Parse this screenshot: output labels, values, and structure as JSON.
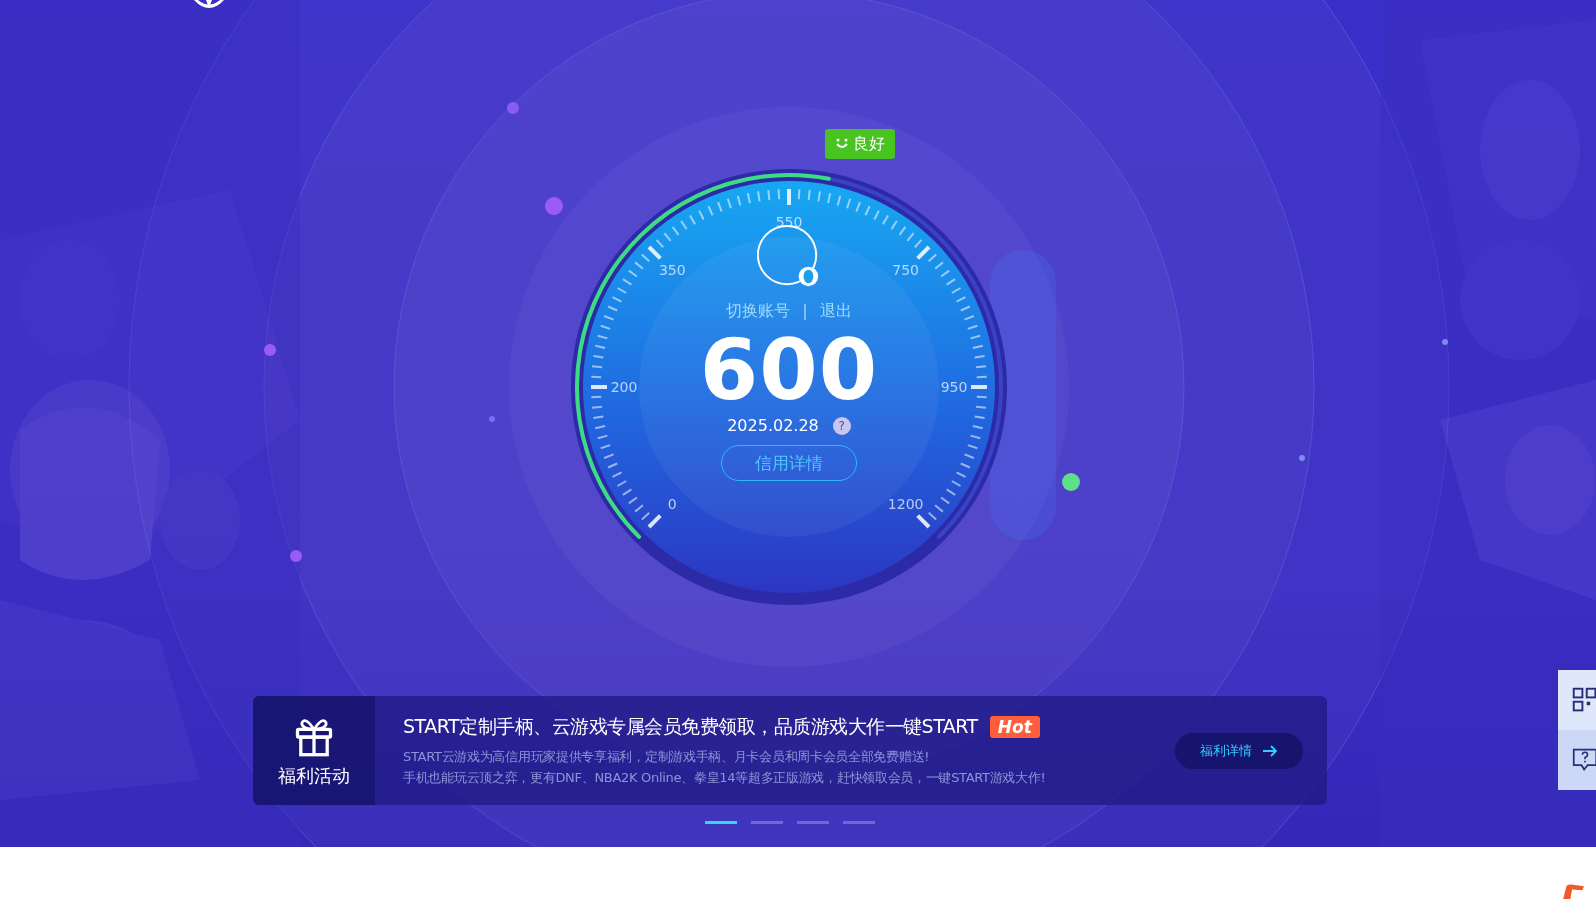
{
  "credit": {
    "status": "良好",
    "scale_labels": [
      "0",
      "200",
      "350",
      "550",
      "750",
      "950",
      "1200"
    ],
    "level": 0.54,
    "account_links": [
      {
        "label": "切换账号"
      },
      {
        "label": "退出"
      }
    ],
    "separator": "|",
    "score": "600",
    "date": "2025.02.28",
    "help": "?",
    "details_button": "信用详情"
  },
  "promo": {
    "section_label": "福利活动",
    "title": "START定制手柄、云游戏专属会员免费领取，品质游戏大作一键START",
    "tag": "Hot",
    "lines": [
      "START云游戏为高信用玩家提供专享福利，定制游戏手柄、月卡会员和周卡会员全部免费赠送!",
      "手机也能玩云顶之弈，更有DNF、NBA2K Online、拳皇14等超多正版游戏，赶快领取会员，一键START游戏大作!"
    ],
    "button": "福利详情"
  },
  "carousel": {
    "dots": [
      {
        "selected": true
      },
      {
        "selected": false
      },
      {
        "selected": false
      },
      {
        "selected": false
      }
    ]
  }
}
